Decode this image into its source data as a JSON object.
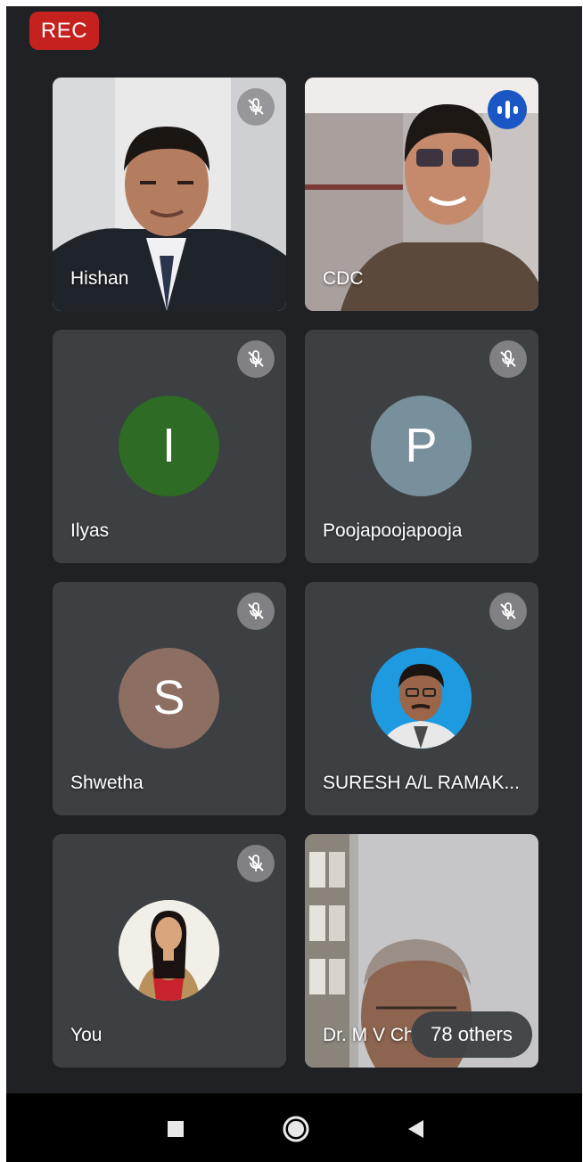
{
  "meeting": {
    "recording_label": "REC",
    "others_label": "78 others",
    "colors": {
      "rec": "#c5221f",
      "tile": "#3c4043",
      "background": "#202124",
      "speaking": "#1a56c4"
    }
  },
  "participants": [
    {
      "name": "Hishan",
      "type": "video",
      "muted": true
    },
    {
      "name": "CDC",
      "type": "video",
      "muted": false,
      "speaking": true
    },
    {
      "name": "Ilyas",
      "type": "initial",
      "initial": "I",
      "avatar_color": "#2e6b24",
      "muted": true
    },
    {
      "name": "Poojapoojapooja",
      "type": "initial",
      "initial": "P",
      "avatar_color": "#78909c",
      "muted": true
    },
    {
      "name": "Shwetha",
      "type": "initial",
      "initial": "S",
      "avatar_color": "#8d6e63",
      "muted": true
    },
    {
      "name": "SURESH A/L RAMAK...",
      "type": "photo",
      "muted": true
    },
    {
      "name": "You",
      "type": "photo",
      "muted": true
    },
    {
      "name": "Dr. M V Ch",
      "type": "video",
      "muted": false
    }
  ],
  "icons": {
    "mute": "mic-off-icon",
    "speaking": "audio-level-icon",
    "nav": [
      "recents-square-icon",
      "home-circle-icon",
      "back-triangle-icon"
    ]
  }
}
